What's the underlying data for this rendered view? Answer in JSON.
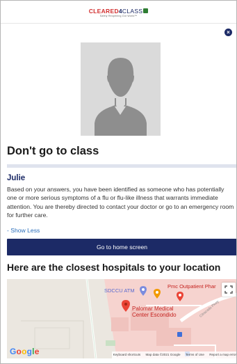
{
  "header": {
    "logo_cleared": "CLEARED",
    "logo_four": "4",
    "logo_class": "CLASS",
    "tagline": "Safely Reopening Our World™"
  },
  "close_label": "×",
  "result": {
    "title": "Don't go to class",
    "name": "Julie",
    "message": "Based on your answers, you have been identified as someone who has potentially one or more serious symptoms of a flu or flu-like illness that warrants immediate attention. You are thereby directed to contact your doctor or go to an emergency room for further care.",
    "show_less": "- Show Less",
    "home_button": "Go to home screen"
  },
  "hospitals": {
    "title": "Here are the closest hospitals to your location"
  },
  "map": {
    "places": {
      "atm": "SDCCU ATM",
      "outpatient": "Pmc Outpatient Phar",
      "palomar_line1": "Palomar Medical",
      "palomar_line2": "Center Escondido",
      "street": "Citracado Pkwy"
    },
    "google": {
      "G": "G",
      "o1": "o",
      "o2": "o",
      "g": "g",
      "l": "l",
      "e": "e"
    },
    "footer": {
      "shortcuts": "Keyboard shortcuts",
      "data": "Map data ©2021 Google",
      "terms": "Terms of Use",
      "report": "Report a map error"
    },
    "colors": {
      "background": "#ebe7e0",
      "hospital_area": "#f6d3cf",
      "road": "#ffffff",
      "pin_red": "#ea4335",
      "pin_orange": "#f29900",
      "atm_blue": "#7b8cde"
    }
  },
  "colors": {
    "brand_navy": "#1c2a66",
    "brand_red": "#d22f2f",
    "link_blue": "#2a6ebb",
    "divider": "#dfe3ee"
  }
}
